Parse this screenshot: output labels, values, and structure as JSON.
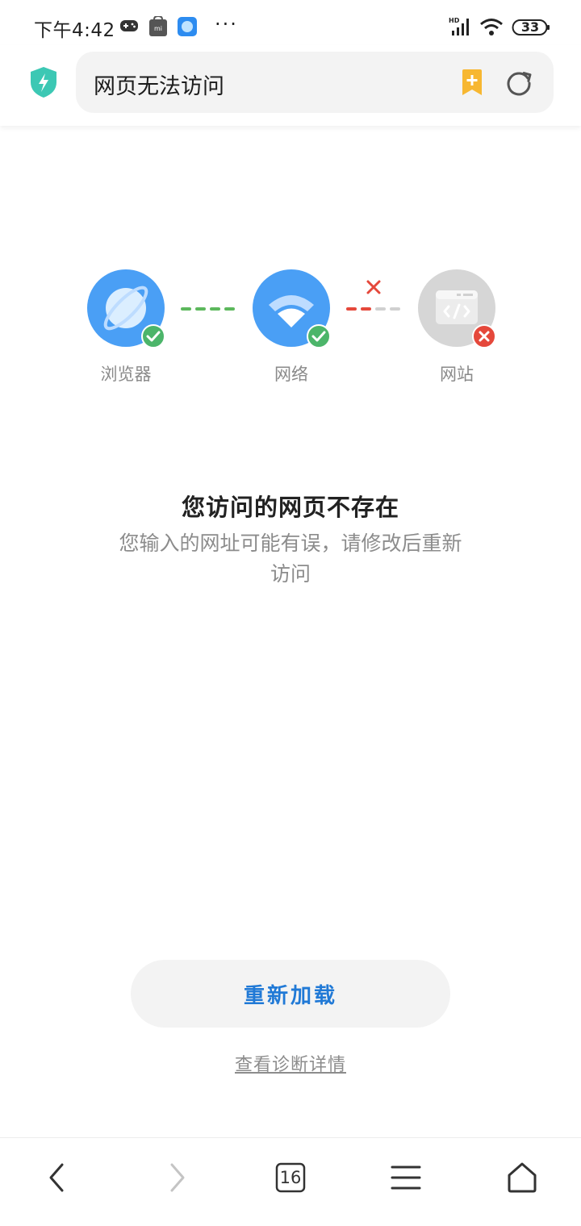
{
  "status_bar": {
    "time": "下午4:42",
    "dots": "···",
    "battery": "33",
    "network_label": "HD"
  },
  "header": {
    "address_text": "网页无法访问",
    "shield_color": "#3cc8b4",
    "bookmark_color": "#f7b731"
  },
  "diagram": {
    "nodes": [
      {
        "label": "浏览器",
        "status": "ok",
        "icon": "planet-icon"
      },
      {
        "label": "网络",
        "status": "ok",
        "icon": "wifi-icon"
      },
      {
        "label": "网站",
        "status": "error",
        "icon": "code-window-icon"
      }
    ],
    "colors": {
      "node_blue": "#4a9ff5",
      "node_gray": "#d6d6d6",
      "ok_green": "#4cb56a",
      "error_red": "#e5483b",
      "dash_green": "#5cb85c",
      "dash_gray": "#d0d0d0"
    }
  },
  "message": {
    "title": "您访问的网页不存在",
    "subtitle": "您输入的网址可能有误，请修改后重新访问"
  },
  "actions": {
    "reload_label": "重新加载",
    "diagnose_label": "查看诊断详情"
  },
  "bottom_nav": {
    "tab_count": "16"
  }
}
